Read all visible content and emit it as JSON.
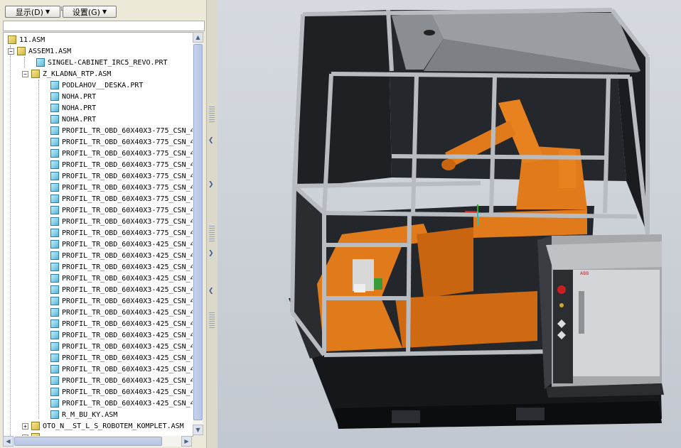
{
  "toolbar": {
    "display_label": "显示(D)",
    "settings_label": "设置(G)"
  },
  "tree": {
    "items": [
      {
        "label": "11.ASM",
        "type": "asm"
      },
      {
        "label": "ASSEM1.ASM",
        "type": "asm"
      },
      {
        "label": "SINGEL-CABINET_IRC5_REVO.PRT",
        "type": "prt"
      },
      {
        "label": "Z_KLADNA_RTP.ASM",
        "type": "asm"
      },
      {
        "label": "PODLAHOV__DESKA.PRT",
        "type": "prt"
      },
      {
        "label": "NOHA.PRT",
        "type": "prt"
      },
      {
        "label": "NOHA.PRT",
        "type": "prt"
      },
      {
        "label": "NOHA.PRT",
        "type": "prt"
      },
      {
        "label": "PROFIL_TR_OBD_60X40X3-775_CSN_4",
        "type": "prt"
      },
      {
        "label": "PROFIL_TR_OBD_60X40X3-775_CSN_4",
        "type": "prt"
      },
      {
        "label": "PROFIL_TR_OBD_60X40X3-775_CSN_4",
        "type": "prt"
      },
      {
        "label": "PROFIL_TR_OBD_60X40X3-775_CSN_4",
        "type": "prt"
      },
      {
        "label": "PROFIL_TR_OBD_60X40X3-775_CSN_4",
        "type": "prt"
      },
      {
        "label": "PROFIL_TR_OBD_60X40X3-775_CSN_4",
        "type": "prt"
      },
      {
        "label": "PROFIL_TR_OBD_60X40X3-775_CSN_4",
        "type": "prt"
      },
      {
        "label": "PROFIL_TR_OBD_60X40X3-775_CSN_4",
        "type": "prt"
      },
      {
        "label": "PROFIL_TR_OBD_60X40X3-775_CSN_4",
        "type": "prt"
      },
      {
        "label": "PROFIL_TR_OBD_60X40X3-775_CSN_4",
        "type": "prt"
      },
      {
        "label": "PROFIL_TR_OBD_60X40X3-425_CSN_4",
        "type": "prt"
      },
      {
        "label": "PROFIL_TR_OBD_60X40X3-425_CSN_4",
        "type": "prt"
      },
      {
        "label": "PROFIL_TR_OBD_60X40X3-425_CSN_4",
        "type": "prt"
      },
      {
        "label": "PROFIL_TR_OBD_60X40X3-425_CSN_4",
        "type": "prt"
      },
      {
        "label": "PROFIL_TR_OBD_60X40X3-425_CSN_4",
        "type": "prt"
      },
      {
        "label": "PROFIL_TR_OBD_60X40X3-425_CSN_4",
        "type": "prt"
      },
      {
        "label": "PROFIL_TR_OBD_60X40X3-425_CSN_4",
        "type": "prt"
      },
      {
        "label": "PROFIL_TR_OBD_60X40X3-425_CSN_4",
        "type": "prt"
      },
      {
        "label": "PROFIL_TR_OBD_60X40X3-425_CSN_4",
        "type": "prt"
      },
      {
        "label": "PROFIL_TR_OBD_60X40X3-425_CSN_4",
        "type": "prt"
      },
      {
        "label": "PROFIL_TR_OBD_60X40X3-425_CSN_4",
        "type": "prt"
      },
      {
        "label": "PROFIL_TR_OBD_60X40X3-425_CSN_4",
        "type": "prt"
      },
      {
        "label": "PROFIL_TR_OBD_60X40X3-425_CSN_4",
        "type": "prt"
      },
      {
        "label": "PROFIL_TR_OBD_60X40X3-425_CSN_4",
        "type": "prt"
      },
      {
        "label": "PROFIL_TR_OBD_60X40X3-425_CSN_4",
        "type": "prt"
      },
      {
        "label": "R_M_BU_KY.ASM",
        "type": "asm"
      },
      {
        "label": "OTO_N__ST_L_S_ROBOTEM_KOMPLET.ASM",
        "type": "asm"
      }
    ]
  },
  "viewport": {
    "cabinet_logo": "ABB"
  },
  "colors": {
    "robot_orange": "#e07a1a",
    "frame_gray": "#b8bcc0",
    "panel_dark": "#1d1f22",
    "viewport_bg": "#cdd2d8"
  }
}
